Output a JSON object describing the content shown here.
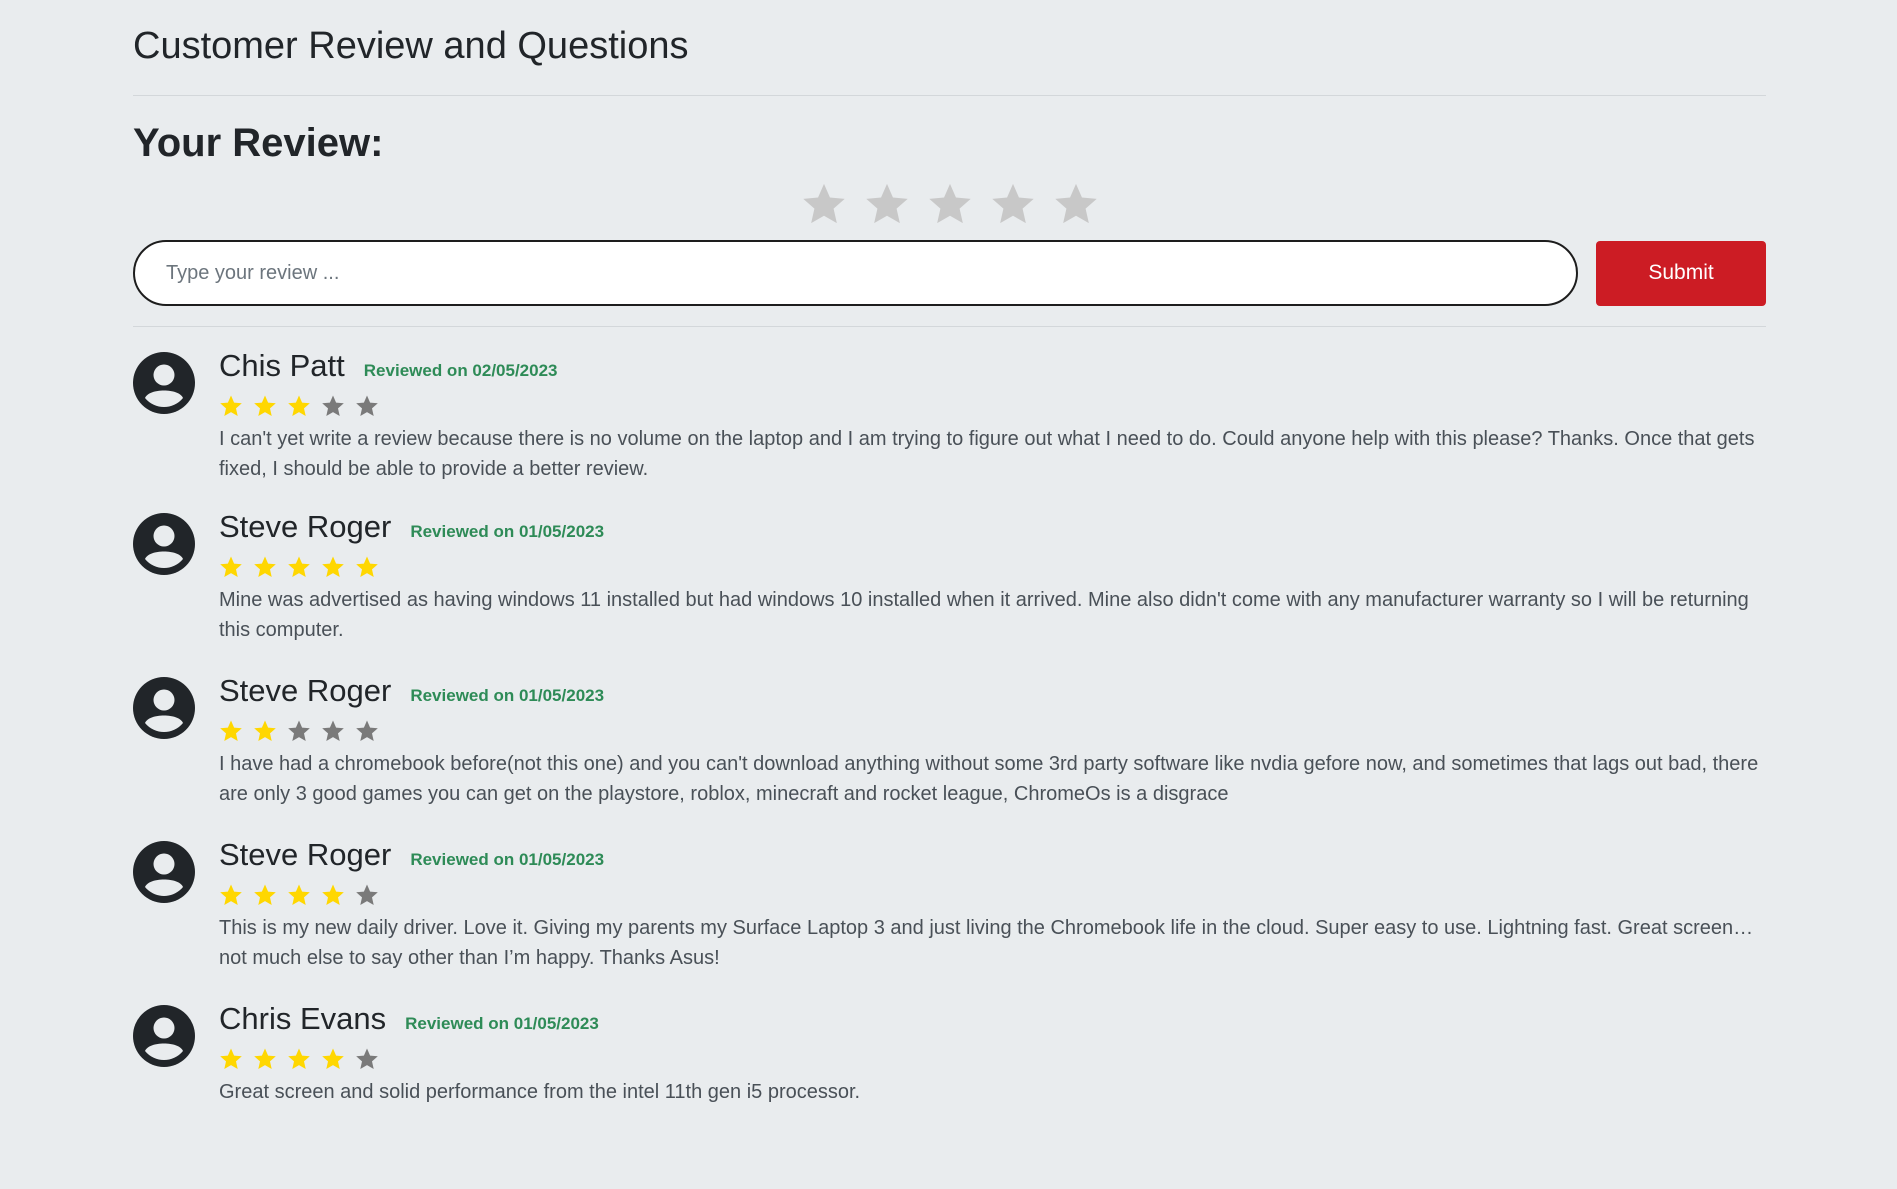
{
  "header": {
    "title": "Customer Review and Questions"
  },
  "form": {
    "heading": "Your Review:",
    "rating_stars": 5,
    "rating_value": 0,
    "placeholder": "Type your review ...",
    "submit_label": "Submit"
  },
  "colors": {
    "accent": "#cc1c24",
    "date": "#2e8b57",
    "star_filled": "#ffd700",
    "star_empty": "#7a7a7a",
    "star_input": "#c8c8c8"
  },
  "reviews": [
    {
      "name": "Chis Patt",
      "date": "Reviewed on 02/05/2023",
      "rating": 3,
      "text": "I can't yet write a review because there is no volume on the laptop and I am trying to figure out what I need to do. Could anyone help with this please? Thanks. Once that gets fixed, I should be able to provide a better review."
    },
    {
      "name": "Steve Roger",
      "date": "Reviewed on 01/05/2023",
      "rating": 5,
      "text": "Mine was advertised as having windows 11 installed but had windows 10 installed when it arrived. Mine also didn't come with any manufacturer warranty so I will be returning this computer."
    },
    {
      "name": "Steve Roger",
      "date": "Reviewed on 01/05/2023",
      "rating": 2,
      "text": "I have had a chromebook before(not this one) and you can't download anything without some 3rd party software like nvdia gefore now, and sometimes that lags out bad, there are only 3 good games you can get on the playstore, roblox, minecraft and rocket league, ChromeOs is a disgrace"
    },
    {
      "name": "Steve Roger",
      "date": "Reviewed on 01/05/2023",
      "rating": 4,
      "text": "This is my new daily driver. Love it. Giving my parents my Surface Laptop 3 and just living the Chromebook life in the cloud. Super easy to use. Lightning fast. Great screen… not much else to say other than I’m happy. Thanks Asus!"
    },
    {
      "name": "Chris Evans",
      "date": "Reviewed on 01/05/2023",
      "rating": 4,
      "text": "Great screen and solid performance from the intel 11th gen i5 processor."
    }
  ]
}
